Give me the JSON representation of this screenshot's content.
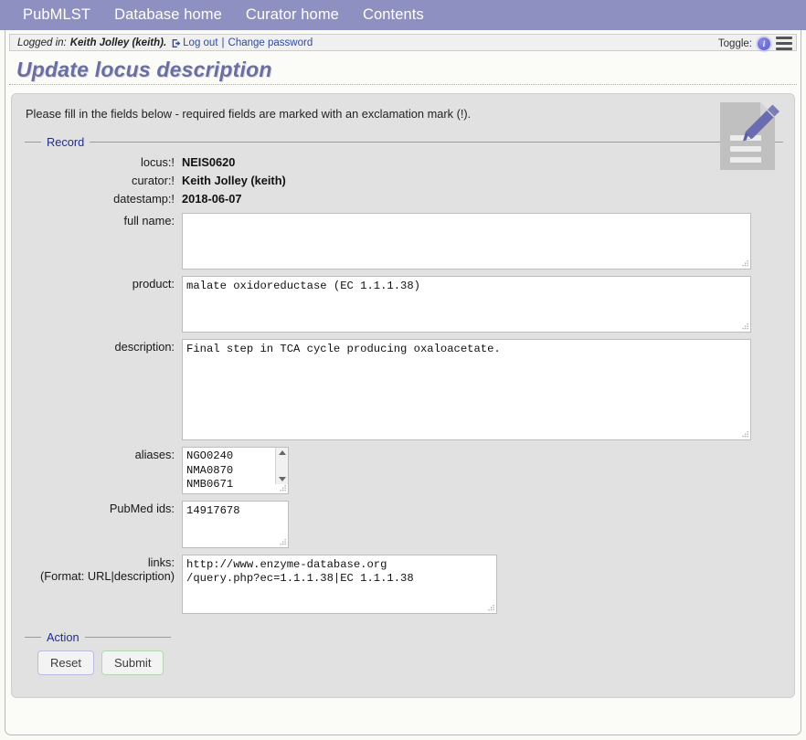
{
  "nav": {
    "items": [
      {
        "label": "PubMLST",
        "name": "nav-pubmlst"
      },
      {
        "label": "Database home",
        "name": "nav-database-home"
      },
      {
        "label": "Curator home",
        "name": "nav-curator-home"
      },
      {
        "label": "Contents",
        "name": "nav-contents"
      }
    ]
  },
  "loginbar": {
    "logged_in_label": "Logged in:",
    "user": "Keith Jolley (keith).",
    "logout_label": "Log out",
    "separator": "|",
    "change_password_label": "Change password",
    "toggle_label": "Toggle:",
    "info_glyph": "i"
  },
  "page": {
    "title": "Update locus description",
    "intro": "Please fill in the fields below - required fields are marked with an exclamation mark (!).",
    "edit_icon_name": "document-edit-icon"
  },
  "record": {
    "legend": "Record",
    "fields": {
      "locus": {
        "label": "locus:!",
        "value": "NEIS0620"
      },
      "curator": {
        "label": "curator:!",
        "value": "Keith Jolley (keith)"
      },
      "datestamp": {
        "label": "datestamp:!",
        "value": "2018-06-07"
      },
      "full_name": {
        "label": "full name:",
        "value": ""
      },
      "product": {
        "label": "product:",
        "value": "malate oxidoreductase (EC 1.1.1.38)"
      },
      "description": {
        "label": "description:",
        "value": "Final step in TCA cycle producing oxaloacetate."
      },
      "aliases": {
        "label": "aliases:",
        "options": [
          "NGO0240",
          "NMA0870",
          "NMB0671"
        ]
      },
      "pubmed_ids": {
        "label": "PubMed ids:",
        "value": "14917678"
      },
      "links": {
        "label": "links:",
        "format_hint": "(Format: URL|description)",
        "value": "http://www.enzyme-database.org/query.php?ec=1.1.1.38|EC 1.1.1.38"
      }
    }
  },
  "action": {
    "legend": "Action",
    "reset_label": "Reset",
    "submit_label": "Submit"
  },
  "colors": {
    "navbar": "#8e90c1",
    "title": "#6a6fa0",
    "legend": "#202d8f",
    "link": "#2e4b9e",
    "content_bg": "#e1e1e1",
    "submit_border": "#b2d8b2",
    "reset_border": "#b9bbdf",
    "info_icon": "#6a6bd8"
  }
}
